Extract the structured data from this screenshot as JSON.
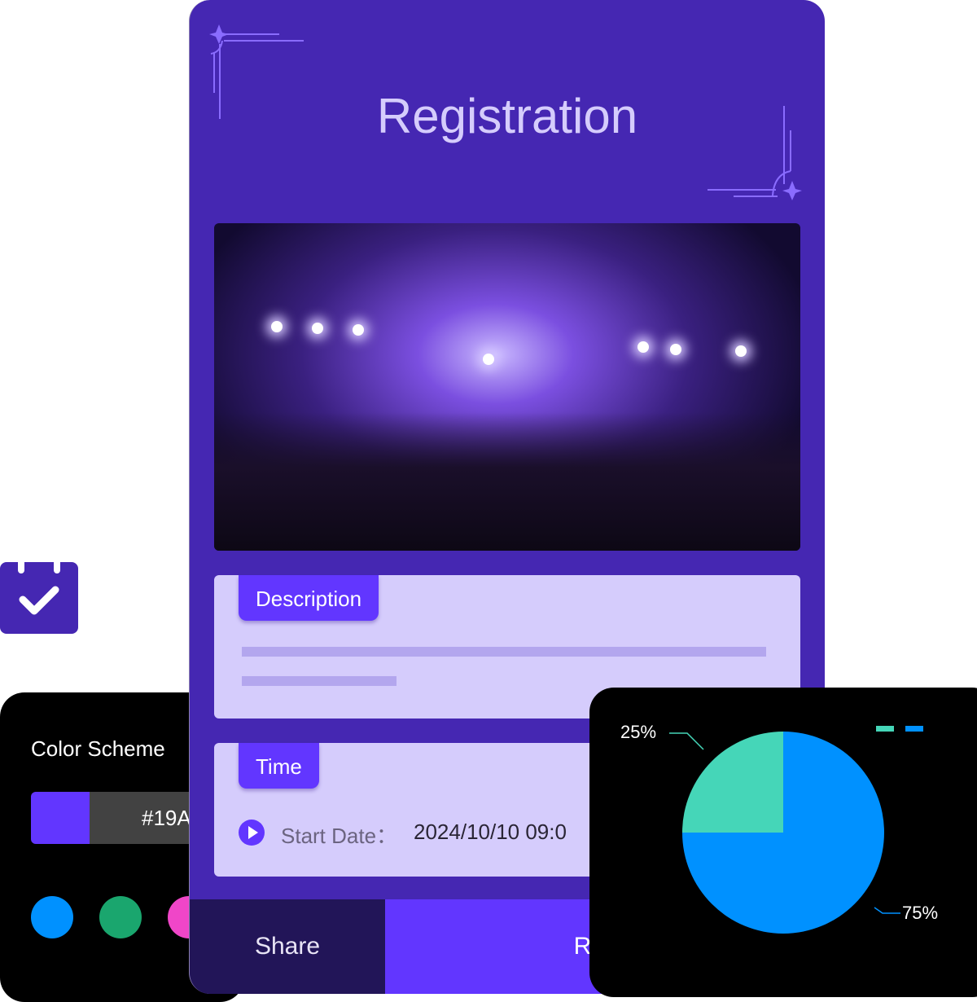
{
  "color_scheme": {
    "title": "Color Scheme",
    "primary_hex": "#19A",
    "primary_color": "#6236FF",
    "palette": [
      "#0091FF",
      "#1AA66E",
      "#F046C8"
    ]
  },
  "registration": {
    "title": "Registration",
    "description_label": "Description",
    "time_label": "Time",
    "start_date_label": "Start Date：",
    "start_date_value": "2024/10/10 09:0",
    "share_label": "Share",
    "register_label": "Regis"
  },
  "icons": {
    "calendar": "calendar-check-icon",
    "play": "play-circle-icon"
  },
  "chart_data": {
    "type": "pie",
    "slices": [
      {
        "label": "25%",
        "value": 25,
        "color": "#45D6B8"
      },
      {
        "label": "75%",
        "value": 75,
        "color": "#0091FF"
      }
    ],
    "legend": "top-right"
  }
}
